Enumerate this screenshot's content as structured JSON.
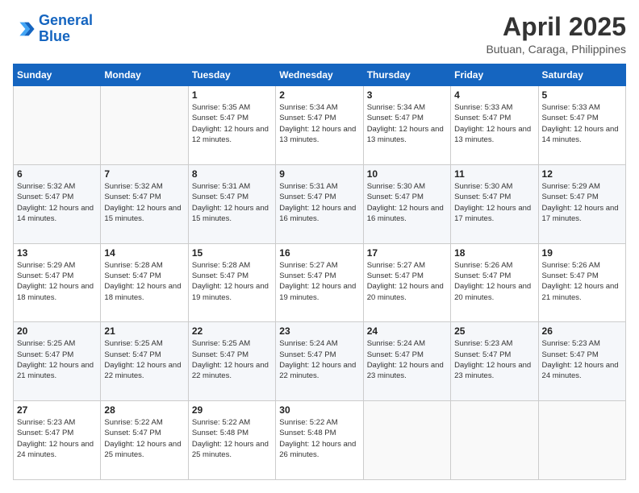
{
  "header": {
    "logo_line1": "General",
    "logo_line2": "Blue",
    "main_title": "April 2025",
    "subtitle": "Butuan, Caraga, Philippines"
  },
  "days_of_week": [
    "Sunday",
    "Monday",
    "Tuesday",
    "Wednesday",
    "Thursday",
    "Friday",
    "Saturday"
  ],
  "weeks": [
    [
      {
        "num": "",
        "sunrise": "",
        "sunset": "",
        "daylight": ""
      },
      {
        "num": "",
        "sunrise": "",
        "sunset": "",
        "daylight": ""
      },
      {
        "num": "1",
        "sunrise": "Sunrise: 5:35 AM",
        "sunset": "Sunset: 5:47 PM",
        "daylight": "Daylight: 12 hours and 12 minutes."
      },
      {
        "num": "2",
        "sunrise": "Sunrise: 5:34 AM",
        "sunset": "Sunset: 5:47 PM",
        "daylight": "Daylight: 12 hours and 13 minutes."
      },
      {
        "num": "3",
        "sunrise": "Sunrise: 5:34 AM",
        "sunset": "Sunset: 5:47 PM",
        "daylight": "Daylight: 12 hours and 13 minutes."
      },
      {
        "num": "4",
        "sunrise": "Sunrise: 5:33 AM",
        "sunset": "Sunset: 5:47 PM",
        "daylight": "Daylight: 12 hours and 13 minutes."
      },
      {
        "num": "5",
        "sunrise": "Sunrise: 5:33 AM",
        "sunset": "Sunset: 5:47 PM",
        "daylight": "Daylight: 12 hours and 14 minutes."
      }
    ],
    [
      {
        "num": "6",
        "sunrise": "Sunrise: 5:32 AM",
        "sunset": "Sunset: 5:47 PM",
        "daylight": "Daylight: 12 hours and 14 minutes."
      },
      {
        "num": "7",
        "sunrise": "Sunrise: 5:32 AM",
        "sunset": "Sunset: 5:47 PM",
        "daylight": "Daylight: 12 hours and 15 minutes."
      },
      {
        "num": "8",
        "sunrise": "Sunrise: 5:31 AM",
        "sunset": "Sunset: 5:47 PM",
        "daylight": "Daylight: 12 hours and 15 minutes."
      },
      {
        "num": "9",
        "sunrise": "Sunrise: 5:31 AM",
        "sunset": "Sunset: 5:47 PM",
        "daylight": "Daylight: 12 hours and 16 minutes."
      },
      {
        "num": "10",
        "sunrise": "Sunrise: 5:30 AM",
        "sunset": "Sunset: 5:47 PM",
        "daylight": "Daylight: 12 hours and 16 minutes."
      },
      {
        "num": "11",
        "sunrise": "Sunrise: 5:30 AM",
        "sunset": "Sunset: 5:47 PM",
        "daylight": "Daylight: 12 hours and 17 minutes."
      },
      {
        "num": "12",
        "sunrise": "Sunrise: 5:29 AM",
        "sunset": "Sunset: 5:47 PM",
        "daylight": "Daylight: 12 hours and 17 minutes."
      }
    ],
    [
      {
        "num": "13",
        "sunrise": "Sunrise: 5:29 AM",
        "sunset": "Sunset: 5:47 PM",
        "daylight": "Daylight: 12 hours and 18 minutes."
      },
      {
        "num": "14",
        "sunrise": "Sunrise: 5:28 AM",
        "sunset": "Sunset: 5:47 PM",
        "daylight": "Daylight: 12 hours and 18 minutes."
      },
      {
        "num": "15",
        "sunrise": "Sunrise: 5:28 AM",
        "sunset": "Sunset: 5:47 PM",
        "daylight": "Daylight: 12 hours and 19 minutes."
      },
      {
        "num": "16",
        "sunrise": "Sunrise: 5:27 AM",
        "sunset": "Sunset: 5:47 PM",
        "daylight": "Daylight: 12 hours and 19 minutes."
      },
      {
        "num": "17",
        "sunrise": "Sunrise: 5:27 AM",
        "sunset": "Sunset: 5:47 PM",
        "daylight": "Daylight: 12 hours and 20 minutes."
      },
      {
        "num": "18",
        "sunrise": "Sunrise: 5:26 AM",
        "sunset": "Sunset: 5:47 PM",
        "daylight": "Daylight: 12 hours and 20 minutes."
      },
      {
        "num": "19",
        "sunrise": "Sunrise: 5:26 AM",
        "sunset": "Sunset: 5:47 PM",
        "daylight": "Daylight: 12 hours and 21 minutes."
      }
    ],
    [
      {
        "num": "20",
        "sunrise": "Sunrise: 5:25 AM",
        "sunset": "Sunset: 5:47 PM",
        "daylight": "Daylight: 12 hours and 21 minutes."
      },
      {
        "num": "21",
        "sunrise": "Sunrise: 5:25 AM",
        "sunset": "Sunset: 5:47 PM",
        "daylight": "Daylight: 12 hours and 22 minutes."
      },
      {
        "num": "22",
        "sunrise": "Sunrise: 5:25 AM",
        "sunset": "Sunset: 5:47 PM",
        "daylight": "Daylight: 12 hours and 22 minutes."
      },
      {
        "num": "23",
        "sunrise": "Sunrise: 5:24 AM",
        "sunset": "Sunset: 5:47 PM",
        "daylight": "Daylight: 12 hours and 22 minutes."
      },
      {
        "num": "24",
        "sunrise": "Sunrise: 5:24 AM",
        "sunset": "Sunset: 5:47 PM",
        "daylight": "Daylight: 12 hours and 23 minutes."
      },
      {
        "num": "25",
        "sunrise": "Sunrise: 5:23 AM",
        "sunset": "Sunset: 5:47 PM",
        "daylight": "Daylight: 12 hours and 23 minutes."
      },
      {
        "num": "26",
        "sunrise": "Sunrise: 5:23 AM",
        "sunset": "Sunset: 5:47 PM",
        "daylight": "Daylight: 12 hours and 24 minutes."
      }
    ],
    [
      {
        "num": "27",
        "sunrise": "Sunrise: 5:23 AM",
        "sunset": "Sunset: 5:47 PM",
        "daylight": "Daylight: 12 hours and 24 minutes."
      },
      {
        "num": "28",
        "sunrise": "Sunrise: 5:22 AM",
        "sunset": "Sunset: 5:47 PM",
        "daylight": "Daylight: 12 hours and 25 minutes."
      },
      {
        "num": "29",
        "sunrise": "Sunrise: 5:22 AM",
        "sunset": "Sunset: 5:48 PM",
        "daylight": "Daylight: 12 hours and 25 minutes."
      },
      {
        "num": "30",
        "sunrise": "Sunrise: 5:22 AM",
        "sunset": "Sunset: 5:48 PM",
        "daylight": "Daylight: 12 hours and 26 minutes."
      },
      {
        "num": "",
        "sunrise": "",
        "sunset": "",
        "daylight": ""
      },
      {
        "num": "",
        "sunrise": "",
        "sunset": "",
        "daylight": ""
      },
      {
        "num": "",
        "sunrise": "",
        "sunset": "",
        "daylight": ""
      }
    ]
  ]
}
